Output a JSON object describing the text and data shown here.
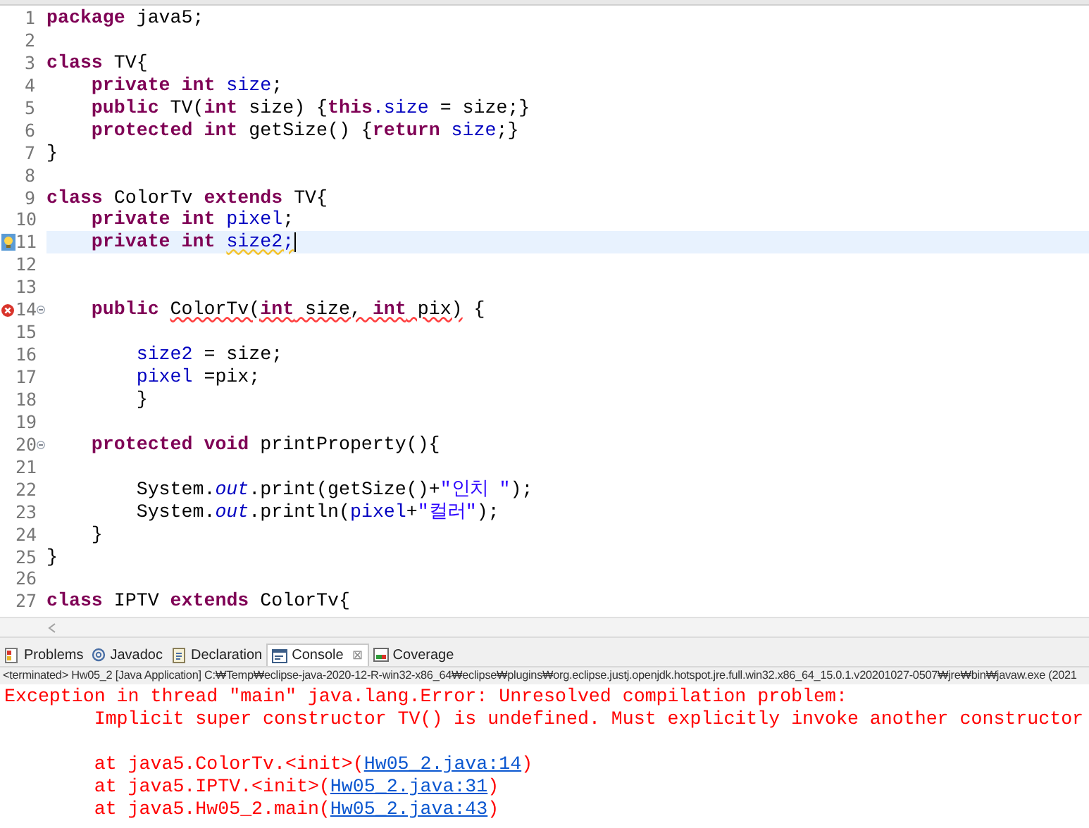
{
  "editor": {
    "lines": [
      {
        "number": "1",
        "tokens": [
          {
            "text": "package",
            "kind": "keyword"
          },
          {
            "text": " java5;",
            "kind": "plain"
          }
        ]
      },
      {
        "number": "2"
      },
      {
        "number": "3",
        "tokens": [
          {
            "text": "class",
            "kind": "keyword"
          },
          {
            "text": " TV{",
            "kind": "plain"
          }
        ]
      },
      {
        "number": "4",
        "tokens": [
          {
            "text": "    private",
            "kind": "keyword"
          },
          {
            "text": " int",
            "kind": "keyword"
          },
          {
            "text": " size",
            "kind": "field"
          },
          {
            "text": ";",
            "kind": "plain"
          }
        ]
      },
      {
        "number": "5",
        "tokens": [
          {
            "text": "    public",
            "kind": "keyword"
          },
          {
            "text": " TV(",
            "kind": "plain"
          },
          {
            "text": "int",
            "kind": "keyword"
          },
          {
            "text": " size) {",
            "kind": "plain"
          },
          {
            "text": "this",
            "kind": "keyword"
          },
          {
            "text": ".size",
            "kind": "field"
          },
          {
            "text": " = size;}",
            "kind": "plain"
          }
        ]
      },
      {
        "number": "6",
        "tokens": [
          {
            "text": "    protected",
            "kind": "keyword"
          },
          {
            "text": " int",
            "kind": "keyword"
          },
          {
            "text": " getSize() {",
            "kind": "plain"
          },
          {
            "text": "return",
            "kind": "keyword"
          },
          {
            "text": " size",
            "kind": "field"
          },
          {
            "text": ";}",
            "kind": "plain"
          }
        ]
      },
      {
        "number": "7",
        "tokens": [
          {
            "text": "}",
            "kind": "plain"
          }
        ]
      },
      {
        "number": "8"
      },
      {
        "number": "9",
        "tokens": [
          {
            "text": "class",
            "kind": "keyword"
          },
          {
            "text": " ColorTv ",
            "kind": "plain"
          },
          {
            "text": "extends",
            "kind": "keyword"
          },
          {
            "text": " TV{",
            "kind": "plain"
          }
        ]
      },
      {
        "number": "10",
        "tokens": [
          {
            "text": "    private",
            "kind": "keyword"
          },
          {
            "text": " int",
            "kind": "keyword"
          },
          {
            "text": " pixel",
            "kind": "field"
          },
          {
            "text": ";",
            "kind": "plain"
          }
        ]
      },
      {
        "number": "11",
        "highlighted": true,
        "quick_fix": true,
        "tokens": [
          {
            "text": "    private",
            "kind": "keyword"
          },
          {
            "text": " int ",
            "kind": "keyword"
          },
          {
            "text": "size2;",
            "kind": "field",
            "warning": true
          }
        ]
      },
      {
        "number": "12"
      },
      {
        "number": "13"
      },
      {
        "number": "14",
        "error": true,
        "fold": true,
        "tokens": [
          {
            "text": "    public ",
            "kind": "keyword"
          },
          {
            "text": "ColorTv(",
            "kind": "plain",
            "error": true
          },
          {
            "text": "int",
            "kind": "keyword",
            "error": true
          },
          {
            "text": " size, ",
            "kind": "plain",
            "error": true
          },
          {
            "text": "int",
            "kind": "keyword",
            "error": true
          },
          {
            "text": " pix)",
            "kind": "plain",
            "error": true
          },
          {
            "text": " {",
            "kind": "plain"
          }
        ]
      },
      {
        "number": "15"
      },
      {
        "number": "16",
        "tokens": [
          {
            "text": "        size2",
            "kind": "field"
          },
          {
            "text": " = size;",
            "kind": "plain"
          }
        ]
      },
      {
        "number": "17",
        "tokens": [
          {
            "text": "        pixel",
            "kind": "field"
          },
          {
            "text": " =pix;",
            "kind": "plain"
          }
        ]
      },
      {
        "number": "18",
        "tokens": [
          {
            "text": "        }",
            "kind": "plain"
          }
        ]
      },
      {
        "number": "19"
      },
      {
        "number": "20",
        "fold": true,
        "tokens": [
          {
            "text": "    protected",
            "kind": "keyword"
          },
          {
            "text": " void",
            "kind": "keyword"
          },
          {
            "text": " printProperty(){",
            "kind": "plain"
          }
        ]
      },
      {
        "number": "21"
      },
      {
        "number": "22",
        "tokens": [
          {
            "text": "        System.",
            "kind": "plain"
          },
          {
            "text": "out",
            "kind": "static"
          },
          {
            "text": ".print(getSize()+",
            "kind": "plain"
          },
          {
            "text": "\"인치 \"",
            "kind": "string"
          },
          {
            "text": ");",
            "kind": "plain"
          }
        ]
      },
      {
        "number": "23",
        "tokens": [
          {
            "text": "        System.",
            "kind": "plain"
          },
          {
            "text": "out",
            "kind": "static"
          },
          {
            "text": ".println(",
            "kind": "plain"
          },
          {
            "text": "pixel",
            "kind": "field"
          },
          {
            "text": "+",
            "kind": "plain"
          },
          {
            "text": "\"컬러\"",
            "kind": "string"
          },
          {
            "text": ");",
            "kind": "plain"
          }
        ]
      },
      {
        "number": "24",
        "tokens": [
          {
            "text": "    }",
            "kind": "plain"
          }
        ]
      },
      {
        "number": "25",
        "tokens": [
          {
            "text": "}",
            "kind": "plain"
          }
        ]
      },
      {
        "number": "26"
      },
      {
        "number": "27",
        "tokens": [
          {
            "text": "class",
            "kind": "keyword"
          },
          {
            "text": " IPTV ",
            "kind": "plain"
          },
          {
            "text": "extends",
            "kind": "keyword"
          },
          {
            "text": " ColorTv{",
            "kind": "plain"
          }
        ]
      }
    ]
  },
  "views": {
    "tabs": [
      {
        "label": "Problems",
        "selected": false
      },
      {
        "label": "Javadoc",
        "selected": false
      },
      {
        "label": "Declaration",
        "selected": false
      },
      {
        "label": "Console",
        "selected": true,
        "close": "⊠"
      },
      {
        "label": "Coverage",
        "selected": false
      }
    ],
    "console": {
      "description": "<terminated> Hw05_2 [Java Application] C:₩Temp₩eclipse-java-2020-12-R-win32-x86_64₩eclipse₩plugins₩org.eclipse.justj.openjdk.hotspot.jre.full.win32.x86_64_15.0.1.v20201027-0507₩jre₩bin₩javaw.exe  (2021",
      "lines": [
        {
          "segments": [
            {
              "text": "Exception in thread \"main\" java.lang.Error: Unresolved compilation problem: ",
              "kind": "error"
            }
          ]
        },
        {
          "segments": [
            {
              "text": "\tImplicit super constructor TV() is undefined. Must explicitly invoke another constructor",
              "kind": "error"
            }
          ]
        },
        {
          "spaced": true,
          "segments": [
            {
              "text": "\tat java5.ColorTv.<init>(",
              "kind": "error"
            },
            {
              "text": "Hw05_2.java:14",
              "kind": "link"
            },
            {
              "text": ")",
              "kind": "error"
            }
          ]
        },
        {
          "segments": [
            {
              "text": "\tat java5.IPTV.<init>(",
              "kind": "error"
            },
            {
              "text": "Hw05_2.java:31",
              "kind": "link"
            },
            {
              "text": ")",
              "kind": "error"
            }
          ]
        },
        {
          "segments": [
            {
              "text": "\tat java5.Hw05_2.main(",
              "kind": "error"
            },
            {
              "text": "Hw05_2.java:43",
              "kind": "link"
            },
            {
              "text": ")",
              "kind": "error"
            }
          ]
        }
      ]
    }
  }
}
